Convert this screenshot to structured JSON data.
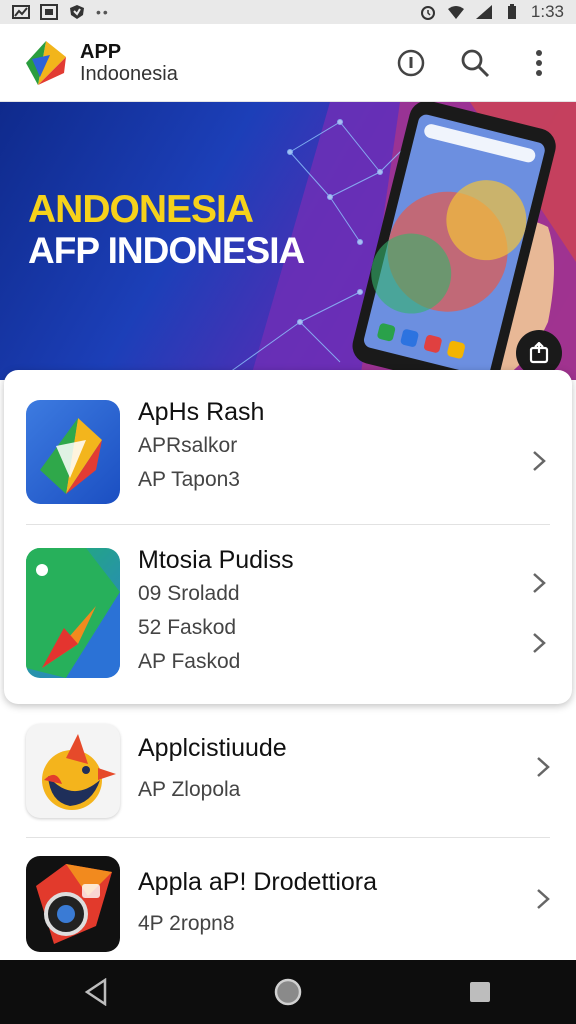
{
  "status_bar": {
    "time": "1:33"
  },
  "app_bar": {
    "brand_top": "APP",
    "brand_bottom": "Indoonesia"
  },
  "banner": {
    "line1": "ANDONESIA",
    "line2": "AFP INDONESIA"
  },
  "featured_apps": [
    {
      "title": "ApHs Rash",
      "lines": [
        "APRsalkor",
        "AP Tapon3"
      ]
    },
    {
      "title": "Mtosia Pudiss",
      "lines": [
        "09 Sroladd",
        "52 Faskod",
        "AP Faskod"
      ]
    }
  ],
  "apps": [
    {
      "title": "Applcistiuude",
      "lines": [
        "AP Zlopola"
      ]
    },
    {
      "title": "Appla aP! Drodettiora",
      "lines": [
        "4P 2ropn8"
      ]
    }
  ],
  "colors": {
    "accent_yellow": "#f6d21b",
    "banner_blue": "#1c3fb8",
    "nav_bar": "#0d0d0d"
  }
}
